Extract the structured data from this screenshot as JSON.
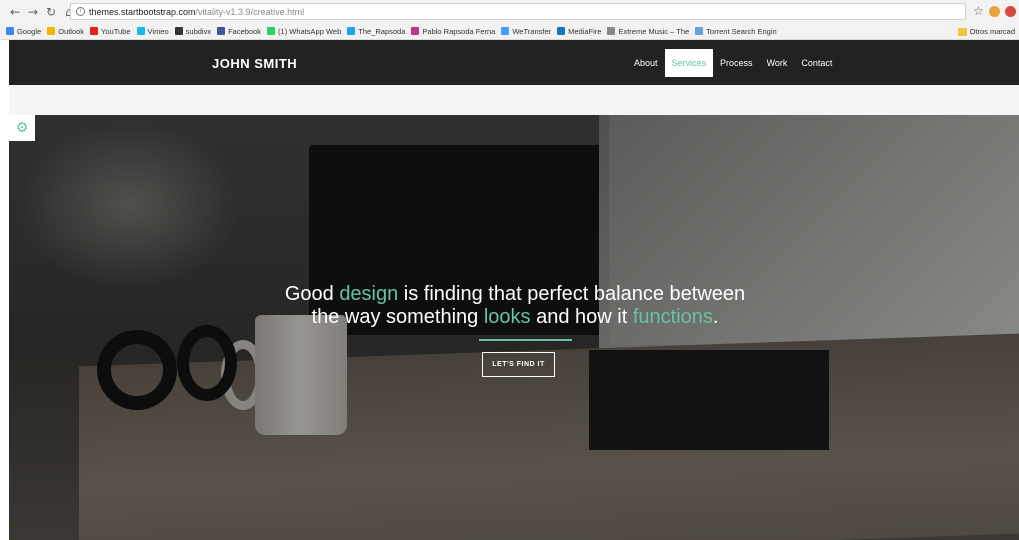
{
  "browser": {
    "url_host": "themes.startbootstrap.com",
    "url_path": "/vitality-v1.3.9/creative.html",
    "bookmarks": [
      {
        "label": "Google",
        "color": "#4285f4"
      },
      {
        "label": "Outlook",
        "color": "#f4b400"
      },
      {
        "label": "YouTube",
        "color": "#e62117"
      },
      {
        "label": "Vimeo",
        "color": "#1ab7ea"
      },
      {
        "label": "subdivx",
        "color": "#333333"
      },
      {
        "label": "Facebook",
        "color": "#3b5998"
      },
      {
        "label": "(1) WhatsApp Web",
        "color": "#25d366"
      },
      {
        "label": "The_Rapsoda",
        "color": "#1da1f2"
      },
      {
        "label": "Pablo Rapsoda Ferna",
        "color": "#c13584"
      },
      {
        "label": "WeTransfer",
        "color": "#409fff"
      },
      {
        "label": "MediaFire",
        "color": "#1b75bb"
      },
      {
        "label": "Extreme Music – The",
        "color": "#888888"
      },
      {
        "label": "Torrent Search Engin",
        "color": "#6a9fd8"
      }
    ],
    "other_bookmarks": "Otros marcad"
  },
  "navbar": {
    "brand": "JOHN SMITH",
    "links": [
      {
        "label": "About",
        "active": false
      },
      {
        "label": "Services",
        "active": true
      },
      {
        "label": "Process",
        "active": false
      },
      {
        "label": "Work",
        "active": false
      },
      {
        "label": "Contact",
        "active": false
      }
    ]
  },
  "hero": {
    "line1_a": "Good ",
    "line1_accent": "design",
    "line1_b": " is finding that perfect balance between",
    "line2_a": "the way something ",
    "line2_accent1": "looks",
    "line2_b": " and how it ",
    "line2_accent2": "functions",
    "line2_c": ".",
    "cta_label": "LET'S FIND IT"
  },
  "colors": {
    "accent": "#68c3a3",
    "navbar_bg": "#222222"
  }
}
